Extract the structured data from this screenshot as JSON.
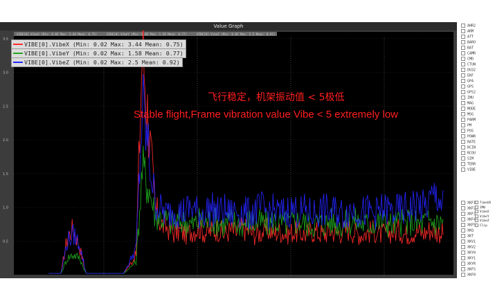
{
  "window": {
    "title": "Value Graph"
  },
  "top_legend": [
    "VIBE[0].VibeX (Min: 0.02 Max: 3.44 Mean: 0.75)",
    "VIBE[0].VibeY (Min: 0.02 Max: 1.58 Mean: 0.77)",
    "VIBE[0].VibeZ (Min: 0.02 Max: 2.5 Mean: 0.92)"
  ],
  "legend": [
    {
      "label": "VIBE[0].VibeX (Min: 0.02 Max: 3.44 Mean: 0.75)",
      "color": "#ff2a2a"
    },
    {
      "label": "VIBE[0].VibeY (Min: 0.02 Max: 1.58 Mean: 0.77)",
      "color": "#1fa51f"
    },
    {
      "label": "VIBE[0].VibeZ (Min: 0.02 Max: 2.5 Mean: 0.92)",
      "color": "#2424ff"
    }
  ],
  "annotations": {
    "chinese": "飞行稳定，机架振动值 < 5极低",
    "english": "Stable flight,Frame vibration value Vibe < 5 extremely low"
  },
  "y_ticks": [
    "3.5",
    "3.0",
    "2.5",
    "2.0",
    "1.5",
    "1.0",
    "0.5"
  ],
  "param_tree": {
    "items": [
      "AHR2",
      "ARM",
      "ATT",
      "BARO",
      "BAT",
      "CAMR",
      "CMD",
      "CTUN",
      "DU32",
      "EKF",
      "GPA",
      "GPS",
      "GPS2",
      "IMU",
      "MAG",
      "MODE",
      "MSG",
      "PARM",
      "PM",
      "POS",
      "POWR",
      "RATE",
      "RCIN",
      "RCOU",
      "SIM",
      "TERR",
      "VIBE",
      "XKF1",
      "XKF2",
      "XKF3",
      "XKF4",
      "XKF5",
      "XKQ",
      "XKT",
      "XKV1",
      "XKV2",
      "XKY0",
      "XKY1",
      "XKYR",
      "XKFS",
      "XKF0"
    ],
    "sub_items": [
      "TimeUS",
      "IMU",
      "VibeX",
      "VibeY",
      "VibeZ",
      "Clip"
    ]
  },
  "chart_data": {
    "type": "line",
    "title": "Value Graph",
    "xlabel": "",
    "ylabel": "",
    "ylim": [
      0,
      3.6
    ],
    "grid": true,
    "legend_position": "top-left",
    "series": [
      {
        "name": "VIBE[0].VibeX",
        "color": "#ff2a2a",
        "values": [
          0.02,
          0.02,
          0.02,
          0.55,
          0.7,
          0.4,
          0.02,
          0.02,
          0.02,
          0.02,
          0.02,
          0.02,
          0.02,
          0.15,
          0.3,
          3.44,
          2.2,
          1.0,
          0.75,
          0.7,
          0.62,
          0.65,
          0.6,
          0.66,
          0.7,
          0.62,
          0.65,
          0.68,
          0.6,
          0.66,
          0.62,
          0.7,
          0.64,
          0.6,
          0.63,
          0.67,
          0.62,
          0.65,
          0.6,
          0.64,
          0.62,
          0.6,
          0.65,
          0.63,
          0.6,
          0.66,
          0.62,
          0.64,
          0.68,
          0.62,
          0.6,
          0.63,
          0.65,
          0.6,
          0.62,
          0.64,
          0.66,
          0.6,
          0.63,
          0.65,
          0.62,
          0.68,
          0.64,
          0.62
        ]
      },
      {
        "name": "VIBE[0].VibeY",
        "color": "#1fa51f",
        "values": [
          0.02,
          0.02,
          0.02,
          0.25,
          0.3,
          0.25,
          0.02,
          0.02,
          0.02,
          0.02,
          0.02,
          0.02,
          0.02,
          0.1,
          0.2,
          1.58,
          1.3,
          0.9,
          0.85,
          0.8,
          0.75,
          0.8,
          0.78,
          0.74,
          0.8,
          0.76,
          0.82,
          0.78,
          0.74,
          0.8,
          0.77,
          0.75,
          0.8,
          0.76,
          0.78,
          0.74,
          0.8,
          0.77,
          0.75,
          0.78,
          0.8,
          0.76,
          0.74,
          0.78,
          0.75,
          0.8,
          0.77,
          0.74,
          0.78,
          0.8,
          0.76,
          0.75,
          0.78,
          0.8,
          0.77,
          0.74,
          0.78,
          0.76,
          0.8,
          0.75,
          0.78,
          0.8,
          0.77,
          0.79
        ]
      },
      {
        "name": "VIBE[0].VibeZ",
        "color": "#2424ff",
        "values": [
          0.02,
          0.02,
          0.02,
          0.5,
          0.6,
          0.45,
          0.02,
          0.02,
          0.02,
          0.02,
          0.02,
          0.02,
          0.02,
          0.2,
          0.4,
          2.5,
          1.8,
          1.1,
          0.95,
          0.9,
          0.98,
          0.92,
          0.95,
          1.0,
          0.9,
          0.94,
          0.98,
          0.92,
          0.95,
          0.9,
          0.96,
          0.93,
          0.9,
          0.95,
          0.98,
          0.92,
          0.95,
          0.9,
          0.94,
          0.97,
          0.92,
          0.95,
          0.9,
          0.93,
          0.96,
          0.92,
          0.94,
          0.9,
          0.95,
          0.98,
          0.92,
          0.94,
          0.9,
          0.95,
          0.97,
          0.92,
          0.95,
          0.98,
          1.0,
          1.05,
          0.98,
          1.1,
          1.2,
          1.0
        ]
      }
    ]
  }
}
